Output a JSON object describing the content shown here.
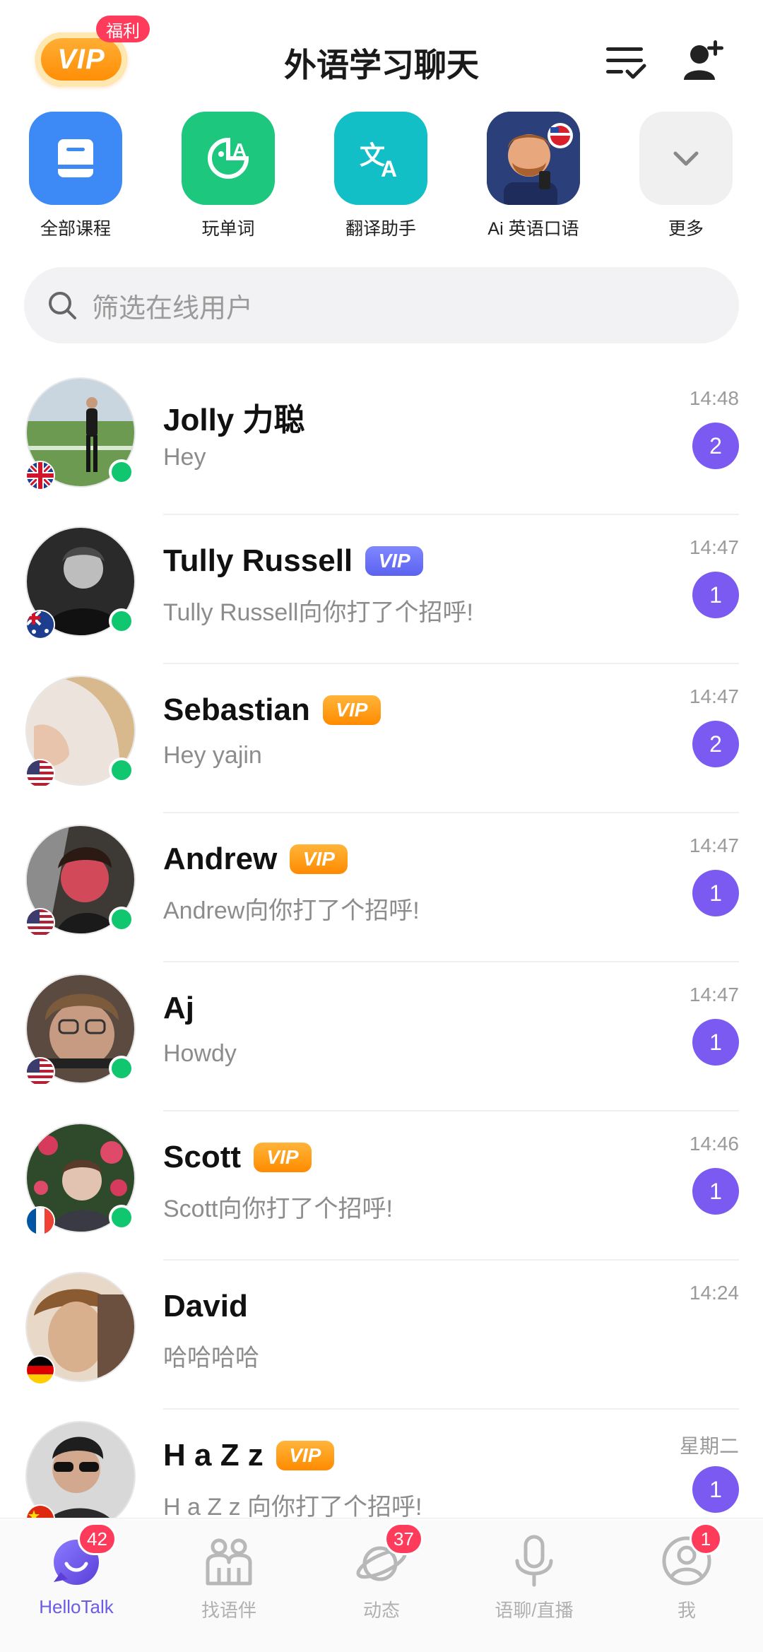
{
  "header": {
    "vip_label": "VIP",
    "welfare_label": "福利",
    "title": "外语学习聊天"
  },
  "shortcuts": [
    {
      "label": "全部课程",
      "icon": "book-icon",
      "color": "#3d8af7"
    },
    {
      "label": "玩单词",
      "icon": "word-game-icon",
      "color": "#1ec77e"
    },
    {
      "label": "翻译助手",
      "icon": "translate-icon",
      "color": "#12bfc7"
    },
    {
      "label": "Ai 英语口语",
      "icon": "ai-tutor-avatar",
      "color": "#2b3f7a"
    },
    {
      "label": "更多",
      "icon": "chevron-down-icon",
      "color": "#f0f0f0"
    }
  ],
  "search": {
    "placeholder": "筛选在线用户"
  },
  "chats": [
    {
      "name": "Jolly 力聪",
      "vip": "",
      "message": "Hey",
      "time": "14:48",
      "unread": "2",
      "online": true,
      "flag": "uk"
    },
    {
      "name": "Tully Russell",
      "vip": "blue",
      "message": "Tully Russell向你打了个招呼!",
      "time": "14:47",
      "unread": "1",
      "online": true,
      "flag": "au"
    },
    {
      "name": "Sebastian",
      "vip": "gold",
      "message": "Hey yajin",
      "time": "14:47",
      "unread": "2",
      "online": true,
      "flag": "us"
    },
    {
      "name": "Andrew",
      "vip": "gold",
      "message": "Andrew向你打了个招呼!",
      "time": "14:47",
      "unread": "1",
      "online": true,
      "flag": "us"
    },
    {
      "name": "Aj",
      "vip": "",
      "message": "Howdy",
      "time": "14:47",
      "unread": "1",
      "online": true,
      "flag": "us"
    },
    {
      "name": "Scott",
      "vip": "gold",
      "message": "Scott向你打了个招呼!",
      "time": "14:46",
      "unread": "1",
      "online": true,
      "flag": "fr"
    },
    {
      "name": "David",
      "vip": "",
      "message": "哈哈哈哈",
      "time": "14:24",
      "unread": "",
      "online": false,
      "flag": "de"
    },
    {
      "name": "H a Z z",
      "vip": "gold",
      "message": "H a Z z 向你打了个招呼!",
      "time": "星期二",
      "unread": "1",
      "online": false,
      "flag": "cn"
    }
  ],
  "vip_tag_text": "VIP",
  "bottom_nav": [
    {
      "label": "HelloTalk",
      "badge": "42",
      "active": true
    },
    {
      "label": "找语伴",
      "badge": "",
      "active": false
    },
    {
      "label": "动态",
      "badge": "37",
      "active": false
    },
    {
      "label": "语聊/直播",
      "badge": "",
      "active": false
    },
    {
      "label": "我",
      "badge": "1",
      "active": false
    }
  ],
  "colors": {
    "accent": "#7a5af0",
    "online": "#10c770",
    "badge_red": "#ff3b5c"
  }
}
